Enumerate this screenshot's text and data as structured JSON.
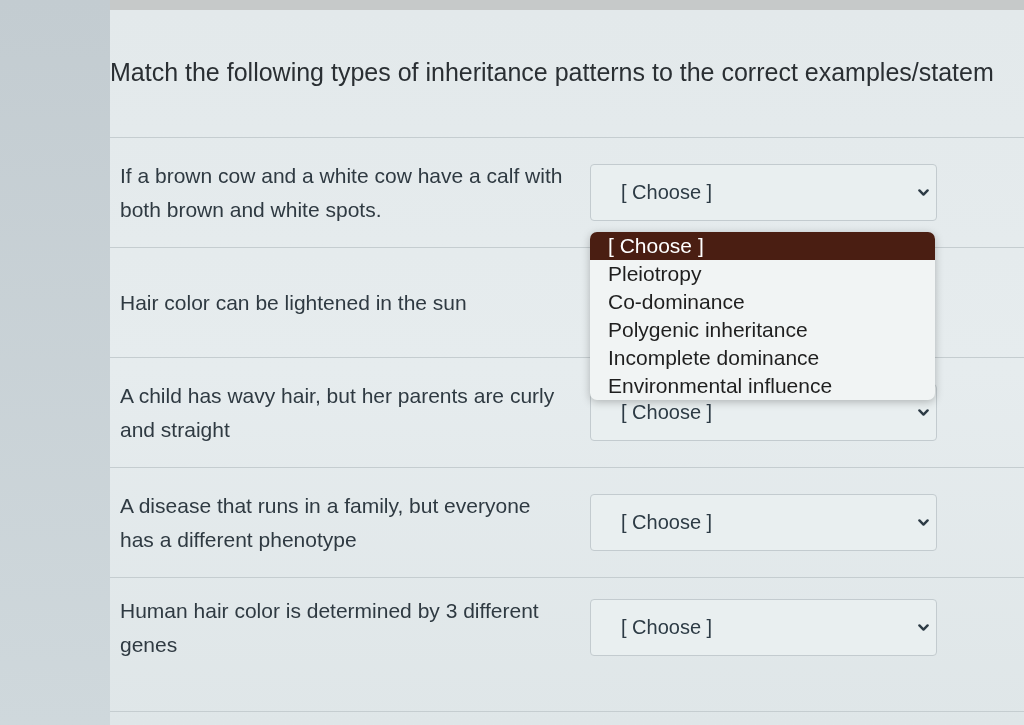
{
  "title": "Match the following types of inheritance patterns to the correct examples/statem",
  "questions": [
    {
      "prompt": "If a brown cow and a white cow have a calf with both brown and white spots.",
      "select": {
        "value": "[ Choose ]",
        "options": [
          {
            "label": "[ Choose ]",
            "selected": true
          },
          {
            "label": "Pleiotropy",
            "selected": false
          },
          {
            "label": "Co-dominance",
            "selected": false
          },
          {
            "label": "Polygenic inheritance",
            "selected": false
          },
          {
            "label": "Incomplete dominance",
            "selected": false
          },
          {
            "label": "Environmental influence",
            "selected": false
          }
        ]
      }
    },
    {
      "prompt": "Hair color can be lightened in the sun"
    },
    {
      "prompt": "A child has wavy hair, but her parents are curly and straight",
      "select": {
        "value": "[ Choose ]"
      }
    },
    {
      "prompt": "A disease that runs in a family, but everyone has a different phenotype",
      "select": {
        "value": "[ Choose ]"
      }
    },
    {
      "prompt": "Human hair color is determined by 3 different genes",
      "select": {
        "value": "[ Choose ]"
      }
    }
  ]
}
